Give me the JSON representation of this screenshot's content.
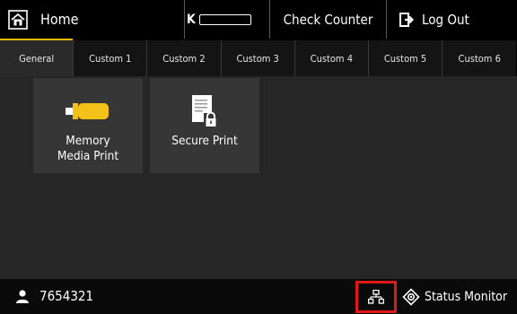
{
  "header": {
    "home_label": "Home",
    "toner_label": "K",
    "check_counter_label": "Check Counter",
    "logout_label": "Log Out"
  },
  "tabs": [
    {
      "label": "General",
      "active": true
    },
    {
      "label": "Custom 1",
      "active": false
    },
    {
      "label": "Custom 2",
      "active": false
    },
    {
      "label": "Custom 3",
      "active": false
    },
    {
      "label": "Custom 4",
      "active": false
    },
    {
      "label": "Custom 5",
      "active": false
    },
    {
      "label": "Custom 6",
      "active": false
    }
  ],
  "tiles": [
    {
      "label": "Memory\nMedia Print",
      "icon": "usb-drive-icon"
    },
    {
      "label": "Secure Print",
      "icon": "secure-document-icon"
    }
  ],
  "status_bar": {
    "user_id": "7654321",
    "network_icon": "network-icon",
    "status_monitor_label": "Status Monitor"
  },
  "colors": {
    "accent": "#f5b400",
    "highlight_box": "#e01818",
    "usb_drive": "#f3c21a"
  }
}
